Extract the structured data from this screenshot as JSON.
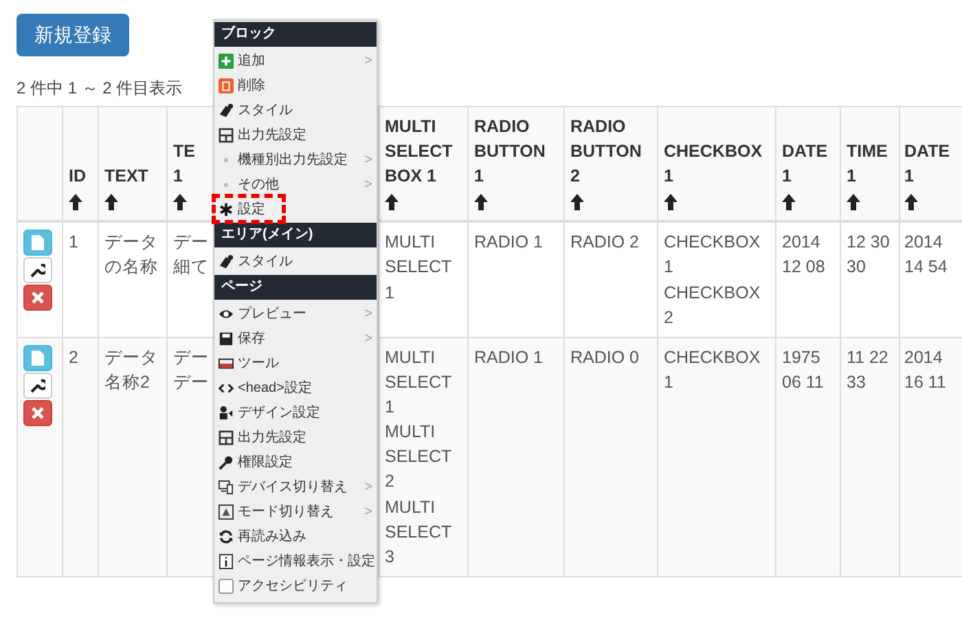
{
  "new_button": "新規登録",
  "summary": "2 件中 1 ～ 2 件目表示",
  "table": {
    "columns": [
      {
        "kind": "actions"
      },
      {
        "kind": "data",
        "label": "ID",
        "sortable": true
      },
      {
        "kind": "data",
        "label": "TEXT",
        "sortable": true
      },
      {
        "kind": "data",
        "label": "TE 1",
        "sortable": true
      },
      {
        "kind": "data",
        "label": "MULTI SELECT BOX 1",
        "sortable": true
      },
      {
        "kind": "data",
        "label": "RADIO BUTTON 1",
        "sortable": true
      },
      {
        "kind": "data",
        "label": "RADIO BUTTON 2",
        "sortable": true
      },
      {
        "kind": "data",
        "label": "CHECKBOX 1",
        "sortable": true
      },
      {
        "kind": "data",
        "label": "DATE 1",
        "sortable": true
      },
      {
        "kind": "data",
        "label": "TIME 1",
        "sortable": true
      },
      {
        "kind": "data",
        "label": "DATE 1",
        "sortable": true
      }
    ],
    "rows": [
      {
        "cells": [
          {
            "kind": "actions"
          },
          {
            "lines": [
              "1"
            ]
          },
          {
            "lines": [
              "データの名称"
            ]
          },
          {
            "lines": [
              "デー",
              "細て"
            ]
          },
          {
            "lines": [
              "MULTI SELECT 1"
            ]
          },
          {
            "lines": [
              "RADIO 1"
            ]
          },
          {
            "lines": [
              "RADIO 2"
            ]
          },
          {
            "lines": [
              "CHECKBOX 1",
              "CHECKBOX 2"
            ]
          },
          {
            "lines": [
              "2014 12 08"
            ]
          },
          {
            "lines": [
              "12 30 30"
            ]
          },
          {
            "lines": [
              "2014 14 54"
            ]
          }
        ]
      },
      {
        "cells": [
          {
            "kind": "actions"
          },
          {
            "lines": [
              "2"
            ]
          },
          {
            "lines": [
              "データ名称2"
            ]
          },
          {
            "lines": [
              "デー",
              "デー"
            ]
          },
          {
            "lines": [
              "MULTI SELECT 1",
              "MULTI SELECT 2",
              "MULTI SELECT 3"
            ]
          },
          {
            "lines": [
              "RADIO 1"
            ]
          },
          {
            "lines": [
              "RADIO 0"
            ]
          },
          {
            "lines": [
              "CHECKBOX 1"
            ]
          },
          {
            "lines": [
              "1975 06 11"
            ]
          },
          {
            "lines": [
              "11 22 33"
            ]
          },
          {
            "lines": [
              "2014 16 11"
            ]
          }
        ]
      }
    ]
  },
  "menu": [
    {
      "kind": "header",
      "label": "ブロック"
    },
    {
      "kind": "item",
      "label": "追加",
      "arrow": ">"
    },
    {
      "kind": "item",
      "label": "削除"
    },
    {
      "kind": "item",
      "label": "スタイル"
    },
    {
      "kind": "item",
      "label": "出力先設定"
    },
    {
      "kind": "item",
      "label": "機種別出力先設定",
      "arrow": ">"
    },
    {
      "kind": "item",
      "label": "その他",
      "arrow": ">"
    },
    {
      "kind": "item",
      "label": "設定",
      "highlighted": true
    },
    {
      "kind": "header",
      "label": "エリア(メイン)"
    },
    {
      "kind": "item",
      "label": "スタイル"
    },
    {
      "kind": "header",
      "label": "ページ"
    },
    {
      "kind": "item",
      "label": "プレビュー",
      "arrow": ">"
    },
    {
      "kind": "item",
      "label": "保存",
      "arrow": ">"
    },
    {
      "kind": "item",
      "label": "ツール"
    },
    {
      "kind": "item",
      "label": "<head>設定"
    },
    {
      "kind": "item",
      "label": "デザイン設定"
    },
    {
      "kind": "item",
      "label": "出力先設定"
    },
    {
      "kind": "item",
      "label": "権限設定"
    },
    {
      "kind": "item",
      "label": "デバイス切り替え",
      "arrow": ">"
    },
    {
      "kind": "item",
      "label": "モード切り替え",
      "arrow": ">"
    },
    {
      "kind": "item",
      "label": "再読み込み"
    },
    {
      "kind": "item",
      "label": "ページ情報表示・設定"
    },
    {
      "kind": "checkbox",
      "label": "アクセシビリティ",
      "checked": false
    }
  ]
}
